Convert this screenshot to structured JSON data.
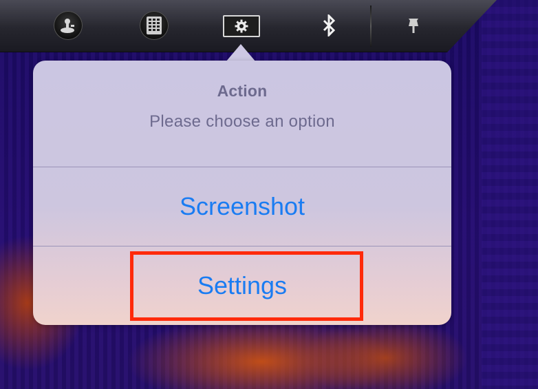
{
  "toolbar": {
    "buttons": [
      {
        "icon": "joystick-icon"
      },
      {
        "icon": "keypad-icon"
      },
      {
        "icon": "gear-icon"
      },
      {
        "icon": "bluetooth-icon"
      },
      {
        "icon": "pin-icon"
      }
    ]
  },
  "action_sheet": {
    "title": "Action",
    "message": "Please choose an option",
    "options": [
      "Screenshot",
      "Settings"
    ],
    "highlighted_option": "Settings"
  },
  "colors": {
    "action_text": "#1a7cf2",
    "header_text": "#6d6a8e",
    "highlight": "#ff2a0a",
    "background": "#1a0a5e"
  }
}
